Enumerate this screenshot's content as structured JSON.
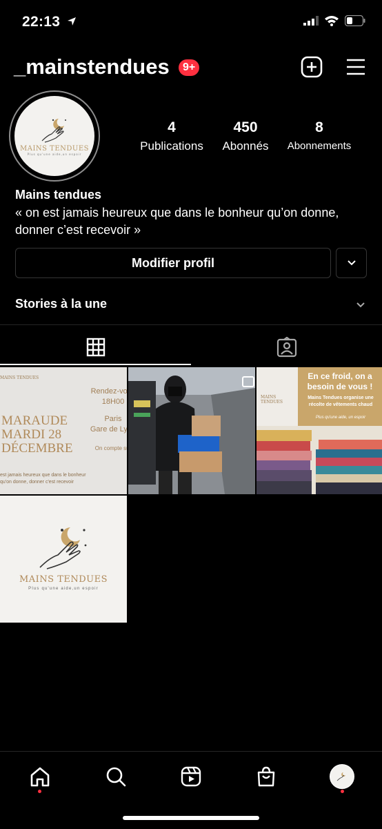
{
  "status_bar": {
    "time": "22:13"
  },
  "header": {
    "username": "_mainstendues",
    "notification_badge": "9+"
  },
  "profile": {
    "avatar_logo_text": "MAINS TENDUES",
    "avatar_logo_sub": "Plus qu'une aide,un espoir",
    "stats": [
      {
        "value": "4",
        "label": "Publications"
      },
      {
        "value": "450",
        "label": "Abonnés"
      },
      {
        "value": "8",
        "label": "Abonnements"
      }
    ],
    "name": "Mains tendues",
    "bio": "« on est jamais heureux que dans le bonheur qu’on donne, donner c’est recevoir »",
    "edit_button": "Modifier profil",
    "stories_label": "Stories à la une"
  },
  "posts": [
    {
      "kind": "text-flyer",
      "logo": "MAINS TENDUES",
      "title_line1": "MARAUDE",
      "title_line2": "MARDI 28",
      "title_line3": "DÉCEMBRE",
      "right_line1": "Rendez-vous",
      "right_line2": "18H00",
      "right_line3": "Paris",
      "right_line4": "Gare de Lyon",
      "right_line5": "On compte sur",
      "quote": "est jamais heureux que dans le bonheur qu'on donne, donner c'est recevoir"
    },
    {
      "kind": "photo",
      "multi": true
    },
    {
      "kind": "appeal",
      "logo": "MAINS TENDUES",
      "headline": "En ce froid, on a besoin de vous !",
      "body": "Mains Tendues organise une récolte de vêtements chaud",
      "tagline": "Plus qu'une aide, un espoir"
    },
    {
      "kind": "logo",
      "logo": "MAINS TENDUES",
      "sub": "Plus qu'une aide,un espoir"
    }
  ],
  "colors": {
    "badge": "#ff3040",
    "gold": "#b89a6a",
    "flyer_bg": "#e6e4e1",
    "appeal_bg": "#c9a66b"
  }
}
